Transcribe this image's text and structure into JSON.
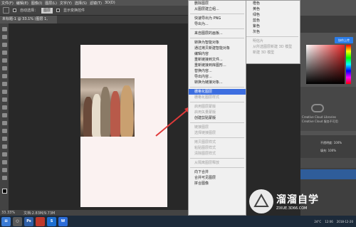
{
  "menubar": {
    "items": [
      "文件(F)",
      "编辑(E)",
      "图像(I)",
      "图层(L)",
      "文字(Y)",
      "选择(S)",
      "滤镜(T)",
      "3D(D)"
    ]
  },
  "options": {
    "auto_select": "自动选择：",
    "group": "图层",
    "show_transform": "显示变换控件"
  },
  "document": {
    "tab": "未标题-1 @ 33.1% (图层 1, RGB/8) *"
  },
  "statusbar": {
    "zoom": "33.33%",
    "docsize": "文档:2.83M/9.73M"
  },
  "layer_menu": {
    "items": [
      {
        "label": "删除图层",
        "state": "normal"
      },
      {
        "label": "从图层建立组...",
        "state": "normal"
      },
      {
        "sep": true
      },
      {
        "label": "快速导出为 PNG",
        "state": "normal"
      },
      {
        "label": "导出为...",
        "state": "normal"
      },
      {
        "sep": true
      },
      {
        "label": "来自图层的画板...",
        "state": "normal"
      },
      {
        "sep": true
      },
      {
        "label": "转换为智能对象",
        "state": "normal"
      },
      {
        "label": "通过拷贝新建智能对象",
        "state": "normal"
      },
      {
        "label": "编辑内容",
        "state": "normal"
      },
      {
        "label": "重新链接到文件...",
        "state": "normal"
      },
      {
        "label": "重新链接到库图形...",
        "state": "normal"
      },
      {
        "label": "替换内容...",
        "state": "normal"
      },
      {
        "label": "导出内容...",
        "state": "normal"
      },
      {
        "label": "转换为链接对象...",
        "state": "normal"
      },
      {
        "sep": true
      },
      {
        "label": "栅格化图层",
        "state": "highlight"
      },
      {
        "label": "栅格化图层样式",
        "state": "disabled"
      },
      {
        "sep": true
      },
      {
        "label": "启用图层蒙版",
        "state": "disabled"
      },
      {
        "label": "启用矢量蒙版",
        "state": "disabled"
      },
      {
        "label": "创建剪贴蒙版",
        "state": "normal"
      },
      {
        "sep": true
      },
      {
        "label": "链接图层",
        "state": "disabled"
      },
      {
        "label": "选择链接图层",
        "state": "disabled"
      },
      {
        "sep": true
      },
      {
        "label": "拷贝图层样式",
        "state": "disabled"
      },
      {
        "label": "粘贴图层样式",
        "state": "disabled"
      },
      {
        "label": "清除图层样式",
        "state": "disabled"
      },
      {
        "sep": true
      },
      {
        "label": "从隔离图层释放",
        "state": "disabled"
      },
      {
        "sep": true
      },
      {
        "label": "向下合并",
        "state": "normal"
      },
      {
        "label": "合并可见图层",
        "state": "normal"
      },
      {
        "label": "拼合图像",
        "state": "normal"
      }
    ]
  },
  "color_menu": {
    "items": [
      {
        "label": "橙色",
        "state": "normal"
      },
      {
        "label": "黄色",
        "state": "normal"
      },
      {
        "label": "绿色",
        "state": "normal"
      },
      {
        "label": "蓝色",
        "state": "normal"
      },
      {
        "label": "紫色",
        "state": "normal"
      },
      {
        "label": "灰色",
        "state": "normal"
      },
      {
        "sep": true
      },
      {
        "label": "明信片",
        "state": "disabled"
      },
      {
        "label": "从所选图层新建 3D 模型",
        "state": "disabled"
      },
      {
        "label": "新建 3D 模型",
        "state": "disabled"
      }
    ]
  },
  "right": {
    "share_label": "协作上传",
    "cc_lines": [
      "Creative Cloud Libraries",
      "Creative Cloud 服务不可用"
    ],
    "opacity_label": "不透明度: 100%",
    "fill_label": "填充: 100%"
  },
  "taskbar": {
    "apps": [
      "Ps",
      "S",
      "W"
    ],
    "temp": "24°C",
    "time": "12:06",
    "date": "2018-12-20"
  },
  "watermark": {
    "title": "溜溜自学",
    "sub": "ZIXUE.3D66.COM"
  },
  "colors": {
    "highlight": "#3d6ee0",
    "share": "#2b7de9",
    "arrow": "#e03a3a"
  }
}
